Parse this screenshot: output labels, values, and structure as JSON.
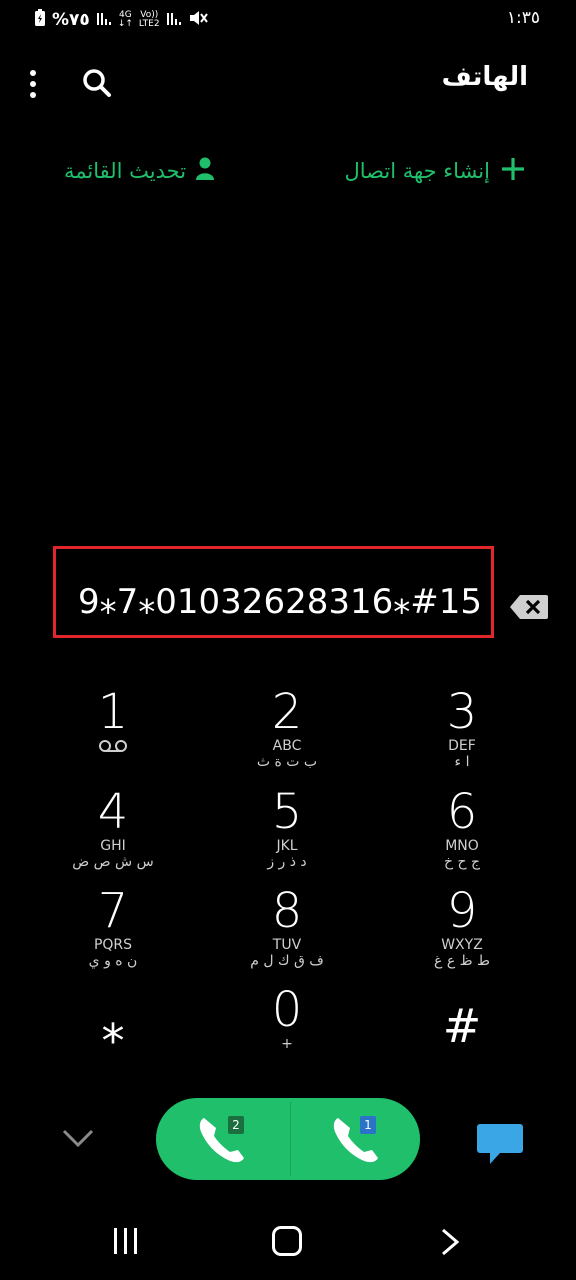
{
  "status_bar": {
    "battery": "%٧٥",
    "network_4g": "4G",
    "network_volte": "Vo))",
    "network_lte": "LTE2",
    "time": "١:٣٥"
  },
  "header": {
    "title": "الهاتف"
  },
  "actions": {
    "create_contact": "إنشاء جهة اتصال",
    "update_list": "تحديث القائمة"
  },
  "dial": {
    "number": "#15⁎01032628316⁎7⁎9"
  },
  "keypad": {
    "keys": [
      {
        "digit": "1",
        "latin": "",
        "arabic": ""
      },
      {
        "digit": "2",
        "latin": "ABC",
        "arabic": "ب ت ة ث"
      },
      {
        "digit": "3",
        "latin": "DEF",
        "arabic": "ا ء"
      },
      {
        "digit": "4",
        "latin": "GHI",
        "arabic": "س ش ص ض"
      },
      {
        "digit": "5",
        "latin": "JKL",
        "arabic": "د ذ ر ز"
      },
      {
        "digit": "6",
        "latin": "MNO",
        "arabic": "ج ح خ"
      },
      {
        "digit": "7",
        "latin": "PQRS",
        "arabic": "ن ه و ي"
      },
      {
        "digit": "8",
        "latin": "TUV",
        "arabic": "ف ق ك ل م"
      },
      {
        "digit": "9",
        "latin": "WXYZ",
        "arabic": "ط ظ ع غ"
      },
      {
        "digit": "⁎",
        "latin": "",
        "arabic": ""
      },
      {
        "digit": "0",
        "latin": "+",
        "arabic": ""
      },
      {
        "digit": "#",
        "latin": "",
        "arabic": ""
      }
    ]
  },
  "calls": {
    "sim2": "2",
    "sim1": "1"
  },
  "colors": {
    "accent": "#1fbf6b",
    "highlight_border": "#e3262b",
    "chat": "#3aa6e6"
  }
}
